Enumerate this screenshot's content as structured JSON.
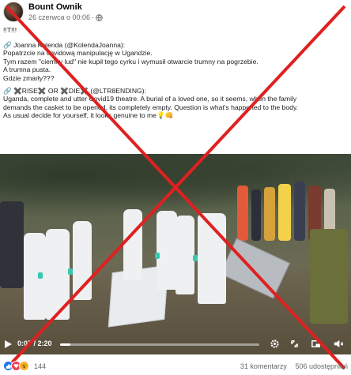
{
  "post": {
    "author": "Bount Ownik",
    "timestamp": "26 czerwca o 00:06",
    "separator": "·",
    "lines": [
      "!!T!!!",
      "🔗 Joanna Kolenda (@KolendaJoanna):",
      "Popatrzcie na covidową manipulację w Ugandzie.",
      "Tym razem \"ciemny lud\" nie kupił tego cyrku i wymusił otwarcie trumny na pogrzebie.",
      "A trumna pusta.",
      "Gdzie zmarły???",
      "🔗 ✖️RISE✖️ OR ✖️DIE✖️ (@LTR8ENDING):",
      "Uganda, complete and utter Covid19 theatre. A burial of a loved one, so it seems, when the family",
      "demands the casket to be opened, its completely empty. Question is what's happened to the body.",
      "As usual decide for yourself, it looks genuine to me💡👊"
    ]
  },
  "video": {
    "current_time": "0:07",
    "duration": "2:20",
    "time_sep": " / ",
    "progress": 0.05
  },
  "footer": {
    "reaction_count": "144",
    "comments": "31 komentarzy",
    "shares": "506 udostępnień"
  },
  "colors": {
    "cross": "#e02020",
    "like": "#1877f2",
    "love": "#f33e58",
    "wow": "#f7b125"
  },
  "icons": [
    "globe-icon",
    "play-icon",
    "settings-icon",
    "fullscreen-icon",
    "volume-icon",
    "like-icon",
    "love-icon",
    "wow-icon"
  ]
}
